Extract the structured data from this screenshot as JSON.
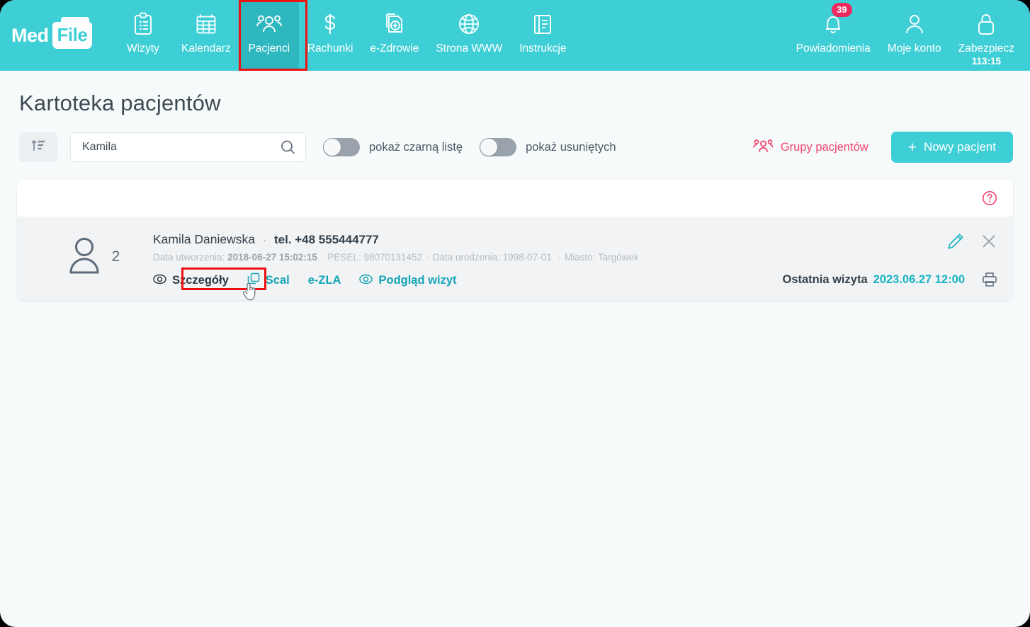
{
  "app": {
    "logo_primary": "Med",
    "logo_secondary": "File",
    "brand_color": "#3ecfd6",
    "accent_pink": "#f4436c",
    "link_color": "#13a5b8"
  },
  "topnav": {
    "items": [
      {
        "label": "Wizyty",
        "icon": "clipboard-icon",
        "active": false
      },
      {
        "label": "Kalendarz",
        "icon": "calendar-icon",
        "active": false
      },
      {
        "label": "Pacjenci",
        "icon": "patients-icon",
        "active": true
      },
      {
        "label": "Rachunki",
        "icon": "dollar-icon",
        "active": false
      },
      {
        "label": "e-Zdrowie",
        "icon": "health-plus-icon",
        "active": false
      },
      {
        "label": "Strona WWW",
        "icon": "globe-icon",
        "active": false
      },
      {
        "label": "Instrukcje",
        "icon": "book-icon",
        "active": false
      }
    ],
    "right_items": [
      {
        "label": "Powiadomienia",
        "icon": "bell-icon",
        "badge": "39"
      },
      {
        "label": "Moje konto",
        "icon": "user-icon",
        "badge": ""
      },
      {
        "label": "Zabezpiecz",
        "icon": "lock-icon",
        "badge": "",
        "subtext": "113:15"
      }
    ]
  },
  "page": {
    "title": "Kartoteka pacjentów"
  },
  "toolbar": {
    "sort_icon": "sort-ascending-icon",
    "search_value": "Kamila",
    "search_placeholder": "",
    "search_icon": "search-icon",
    "toggles": [
      {
        "label": "pokaż czarną listę",
        "on": false
      },
      {
        "label": "pokaż usuniętych",
        "on": false
      }
    ],
    "groups_label": "Grupy pacjentów",
    "groups_icon": "patients-group-icon",
    "new_patient_label": "Nowy pacjent",
    "new_patient_plus": "+"
  },
  "results": {
    "help_icon": "help-circle-icon",
    "patients": [
      {
        "avatar_icon": "person-icon",
        "avatar_count": "2",
        "name": "Kamila Daniewska",
        "separator": "·",
        "phone": "tel. +48 555444777",
        "meta": {
          "created_label": "Data utworzenia:",
          "created_value": "2018-06-27 15:02:15",
          "pesel_label": "PESEL:",
          "pesel_value": "98070131452",
          "birth_label": "Data urodzenia:",
          "birth_value": "1998-07-01",
          "city_label": "Miasto:",
          "city_value": "Targówek",
          "dot": "·"
        },
        "actions": [
          {
            "label": "Szczegóły",
            "icon": "eye-icon",
            "hovered": true
          },
          {
            "label": "Scal",
            "icon": "merge-copy-icon",
            "hovered": false
          },
          {
            "label": "e-ZLA",
            "icon": "",
            "hovered": false
          },
          {
            "label": "Podgląd wizyt",
            "icon": "eye-icon",
            "hovered": false
          }
        ],
        "edit_icon": "pencil-icon",
        "delete_icon": "close-icon",
        "last_visit_label": "Ostatnia wizyta",
        "last_visit_value": "2023.06.27 12:00",
        "print_icon": "printer-icon"
      }
    ]
  }
}
